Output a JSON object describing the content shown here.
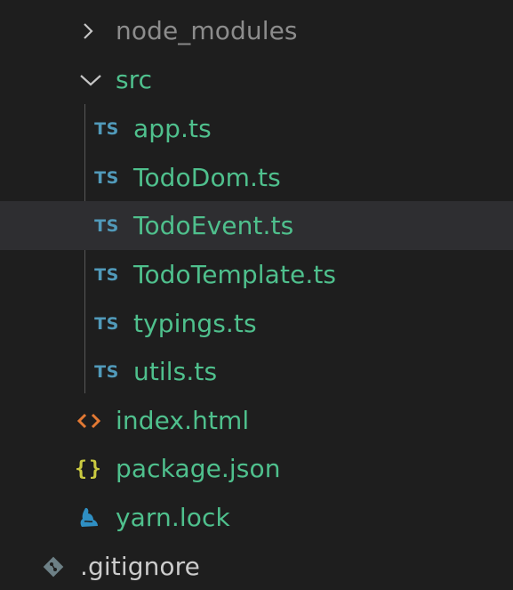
{
  "explorer": {
    "items": [
      {
        "name": "node_modules",
        "kind": "folder",
        "state": "collapsed",
        "icon": "chevron-right-icon",
        "color": "#8c8c8c"
      },
      {
        "name": "src",
        "kind": "folder",
        "state": "expanded",
        "icon": "chevron-down-icon",
        "color": "#4fc08d"
      },
      {
        "name": "app.ts",
        "kind": "file",
        "icon_text": "TS",
        "icon": "typescript-icon",
        "color": "#4fc08d"
      },
      {
        "name": "TodoDom.ts",
        "kind": "file",
        "icon_text": "TS",
        "icon": "typescript-icon",
        "color": "#4fc08d"
      },
      {
        "name": "TodoEvent.ts",
        "kind": "file",
        "icon_text": "TS",
        "icon": "typescript-icon",
        "color": "#4fc08d",
        "selected": true
      },
      {
        "name": "TodoTemplate.ts",
        "kind": "file",
        "icon_text": "TS",
        "icon": "typescript-icon",
        "color": "#4fc08d"
      },
      {
        "name": "typings.ts",
        "kind": "file",
        "icon_text": "TS",
        "icon": "typescript-icon",
        "color": "#4fc08d"
      },
      {
        "name": "utils.ts",
        "kind": "file",
        "icon_text": "TS",
        "icon": "typescript-icon",
        "color": "#4fc08d"
      },
      {
        "name": "index.html",
        "kind": "file",
        "icon": "html-icon",
        "color": "#4fc08d"
      },
      {
        "name": "package.json",
        "kind": "file",
        "icon_text": "{}",
        "icon": "json-icon",
        "color": "#4fc08d"
      },
      {
        "name": "yarn.lock",
        "kind": "file",
        "icon": "yarn-icon",
        "color": "#4fc08d"
      },
      {
        "name": ".gitignore",
        "kind": "file",
        "icon": "git-icon",
        "color": "#cccccc"
      }
    ],
    "colors": {
      "background": "#1e1e1e",
      "selected_row": "#2e2e31",
      "indent_guide": "#585858",
      "ts_badge": "#519aba",
      "json_badge": "#cbcb41",
      "html_badge": "#e37933",
      "yarn_badge": "#2f8fc3",
      "git_badge": "#6d8086"
    }
  }
}
